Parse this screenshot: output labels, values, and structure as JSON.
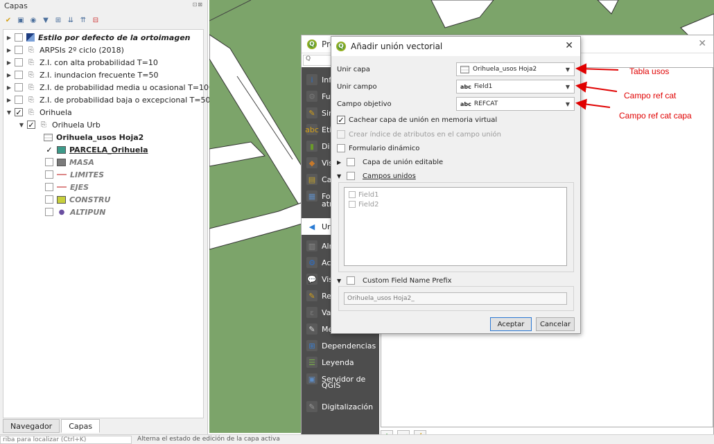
{
  "layers_panel": {
    "title": "Capas",
    "window_buttons": "⊡⊠",
    "items": [
      {
        "label": "Estilo por defecto de la ortoimagen"
      },
      {
        "label": "ARPSIs 2º ciclo (2018)"
      },
      {
        "label": "Z.I. con alta probabilidad T=10"
      },
      {
        "label": "Z.I. inundacion frecuente T=50"
      },
      {
        "label": "Z.I. de probabilidad media u ocasional T=100"
      },
      {
        "label": "Z.I. de probabilidad baja o excepcional T=500"
      },
      {
        "label": "Orihuela"
      },
      {
        "label": "Orihuela Urb"
      },
      {
        "label": "Orihuela_usos Hoja2"
      },
      {
        "label": "PARCELA_Orihuela"
      },
      {
        "label": "MASA"
      },
      {
        "label": "LIMITES"
      },
      {
        "label": "EJES"
      },
      {
        "label": "CONSTRU"
      },
      {
        "label": "ALTIPUN"
      }
    ],
    "tabs": [
      "Navegador",
      "Capas"
    ]
  },
  "status_bar": {
    "locator_placeholder": "riba para localizar (Ctrl+K)",
    "message": "Alterna el estado de edición de la capa activa"
  },
  "props_window": {
    "title": "Pro",
    "search_placeholder": "Q",
    "sidebar": [
      {
        "label": "Inf",
        "icon": "info-icon"
      },
      {
        "label": "Fu",
        "icon": "source-icon"
      },
      {
        "label": "Sin",
        "icon": "symbology-icon"
      },
      {
        "label": "Eti",
        "icon": "labels-icon"
      },
      {
        "label": "Di",
        "icon": "diagrams-icon"
      },
      {
        "label": "Vis",
        "icon": "3d-view-icon"
      },
      {
        "label": "Ca",
        "icon": "fields-icon"
      },
      {
        "label": "Fo",
        "icon": "form-icon"
      },
      {
        "label": "atr",
        "icon": ""
      },
      {
        "label": "Ur",
        "icon": "joins-icon"
      },
      {
        "label": "Alm",
        "icon": "storage-icon"
      },
      {
        "label": "Ac",
        "icon": "actions-icon"
      },
      {
        "label": "Vis",
        "icon": "display-icon"
      },
      {
        "label": "Re",
        "icon": "rendering-icon"
      },
      {
        "label": "Va",
        "icon": "variables-icon"
      },
      {
        "label": "Metadatos",
        "icon": "metadata-icon"
      },
      {
        "label": "Dependencias",
        "icon": "dependencies-icon"
      },
      {
        "label": "Leyenda",
        "icon": "legend-icon"
      },
      {
        "label": "Servidor de",
        "icon": "server-icon"
      },
      {
        "label": "QGIS",
        "icon": ""
      },
      {
        "label": "Digitalización",
        "icon": "digitizing-icon"
      }
    ],
    "bottom_buttons": [
      "+",
      "−",
      "/"
    ]
  },
  "dialog": {
    "title": "Añadir unión vectorial",
    "join_layer_label": "Unir capa",
    "join_layer_value": "Orihuela_usos Hoja2",
    "join_field_label": "Unir campo",
    "join_field_value": "Field1",
    "target_field_label": "Campo objetivo",
    "target_field_value": "REFCAT",
    "abc": "abc",
    "cache_label": "Cachear capa de unión en memoria virtual",
    "index_label": "Crear índice de atributos en el campo unión",
    "dynamic_form_label": "Formulario dinámico",
    "editable_label": "Capa de unión editable",
    "joined_fields_label": "Campos unidos",
    "fields": [
      "Field1",
      "Field2"
    ],
    "prefix_label": "Custom Field Name Prefix",
    "prefix_value": "Orihuela_usos Hoja2_",
    "ok_label": "Aceptar",
    "cancel_label": "Cancelar"
  },
  "annotations": {
    "tabla": "Tabla usos",
    "campo_ref": "Campo ref cat",
    "campo_ref_capa": "Campo ref cat capa",
    "color": "#e00000"
  }
}
